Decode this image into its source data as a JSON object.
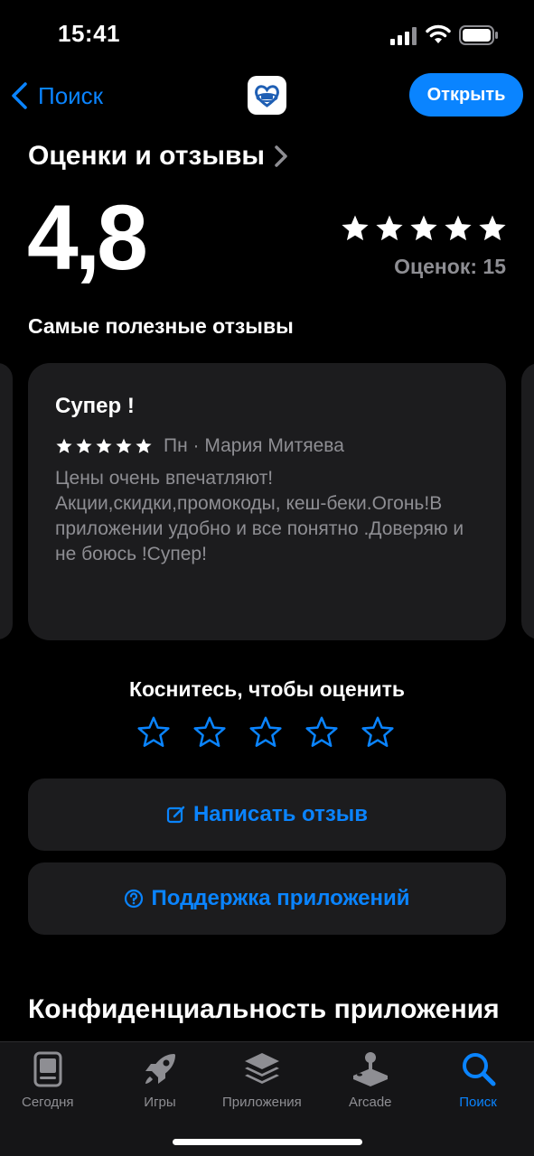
{
  "status_bar": {
    "time": "15:41"
  },
  "nav": {
    "back_label": "Поиск",
    "open_label": "Открыть",
    "app_icon": "app-logo-heart-icon"
  },
  "ratings": {
    "section_title": "Оценки и отзывы",
    "average": "4,8",
    "count_text": "Оценок: 15",
    "stars": 5
  },
  "reviews": {
    "title": "Самые полезные отзывы",
    "items": [
      {
        "title": "Супер !",
        "stars": 5,
        "date": "Пн",
        "author": "Мария Митяева",
        "meta": "Пн · Мария Митяева",
        "body": "Цены очень впечатляют! Акции,скидки,промокоды, кеш-беки.Огонь!В приложении удобно и все понятно .Доверяю и не боюсь !Супер!"
      }
    ]
  },
  "tap_to_rate": {
    "label": "Коснитесь, чтобы оценить",
    "stars": 5
  },
  "actions": {
    "write_review": "Написать отзыв",
    "app_support": "Поддержка приложений"
  },
  "privacy": {
    "title": "Конфиденциальность приложения"
  },
  "tab_bar": {
    "items": [
      {
        "label": "Сегодня",
        "icon": "today-icon",
        "active": false
      },
      {
        "label": "Игры",
        "icon": "rocket-icon",
        "active": false
      },
      {
        "label": "Приложения",
        "icon": "layers-icon",
        "active": false
      },
      {
        "label": "Arcade",
        "icon": "joystick-icon",
        "active": false
      },
      {
        "label": "Поиск",
        "icon": "search-icon",
        "active": true
      }
    ]
  },
  "colors": {
    "accent": "#0a84ff",
    "card": "#1c1c1e",
    "secondary_text": "#8e8e93"
  }
}
